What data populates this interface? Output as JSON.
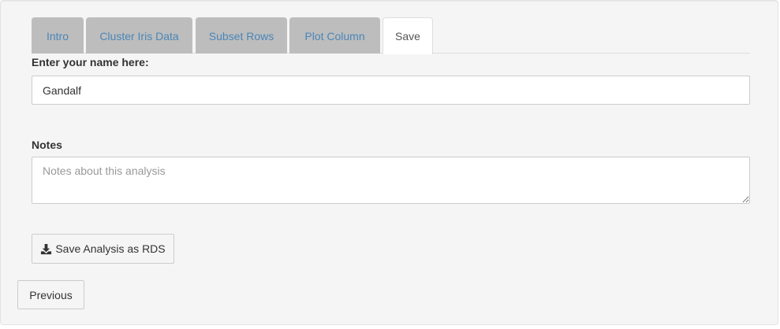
{
  "tabs": [
    {
      "label": "Intro"
    },
    {
      "label": "Cluster Iris Data"
    },
    {
      "label": "Subset Rows"
    },
    {
      "label": "Plot Column"
    },
    {
      "label": "Save"
    }
  ],
  "active_tab": "Save",
  "name_field": {
    "label": "Enter your name here:",
    "value": "Gandalf"
  },
  "notes_field": {
    "label": "Notes",
    "placeholder": "Notes about this analysis",
    "value": ""
  },
  "save_button": {
    "label": "Save Analysis as RDS",
    "icon": "download-icon"
  },
  "previous_button": {
    "label": "Previous"
  },
  "colors": {
    "tab_text": "#4a86b8",
    "inactive_tab_bg": "#bdbdbd",
    "panel_bg": "#f5f5f5"
  }
}
